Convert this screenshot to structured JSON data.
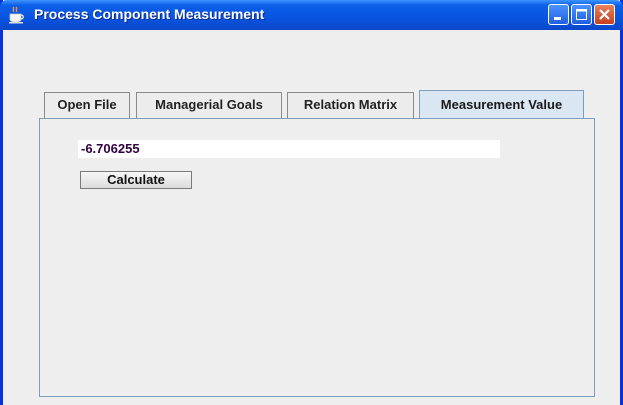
{
  "window": {
    "title": "Process Component Measurement",
    "controls": {
      "minimize": "minimize",
      "maximize": "maximize",
      "close": "close"
    }
  },
  "tabs": [
    {
      "label": "Open File",
      "selected": false
    },
    {
      "label": "Managerial Goals",
      "selected": false
    },
    {
      "label": "Relation Matrix",
      "selected": false
    },
    {
      "label": "Measurement Value",
      "selected": true
    }
  ],
  "measurement": {
    "value": "-6.706255",
    "calculate_label": "Calculate"
  },
  "colors": {
    "titlebar": "#0a54e0",
    "close_button": "#c4401f",
    "selected_tab": "#dbe6f3",
    "value_text": "#330044"
  }
}
